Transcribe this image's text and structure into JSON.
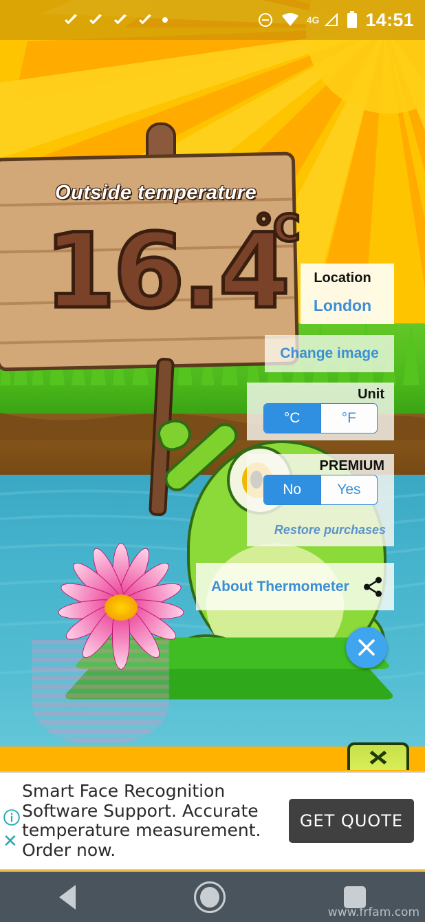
{
  "status_bar": {
    "notification_icons": [
      "check-icon",
      "check-icon",
      "check-icon",
      "check-icon",
      "dot-icon"
    ],
    "dnd_icon": "do-not-disturb-icon",
    "wifi_icon": "wifi-icon",
    "network_label": "4G",
    "signal_icon": "signal-icon",
    "battery_icon": "battery-icon",
    "time": "14:51"
  },
  "scene": {
    "sign_title": "Outside temperature",
    "temperature_value": "16.4",
    "temperature_unit": "°C"
  },
  "settings": {
    "location": {
      "label": "Location",
      "value": "London"
    },
    "change_image_label": "Change image",
    "unit": {
      "label": "Unit",
      "options": [
        "°C",
        "°F"
      ],
      "selected": "°C"
    },
    "premium": {
      "label": "PREMIUM",
      "options": [
        "No",
        "Yes"
      ],
      "selected": "No",
      "restore_label": "Restore purchases"
    },
    "about_label": "About Thermometer",
    "share_icon": "share-icon",
    "close_icon": "close-icon"
  },
  "ad": {
    "tab_icon": "close-x-icon",
    "body": "Smart Face Recognition Software Support. Accurate temperature measurement. Order now.",
    "cta_label": "GET QUOTE",
    "info_icon": "info-icon",
    "close_icon": "close-icon"
  },
  "nav_bar": {
    "back_icon": "back-triangle-icon",
    "home_icon": "home-circle-icon",
    "recents_icon": "recents-square-icon"
  },
  "watermark": "www.frfam.com",
  "colors": {
    "accent_blue": "#3c8fd6",
    "selected_blue": "#2f8fe0",
    "fab_blue": "#3fa5ee",
    "sky_yellow": "#ffc400",
    "grass_green": "#4cb81c",
    "pond_blue": "#45b3cc",
    "nav_gray": "#4a545c"
  }
}
